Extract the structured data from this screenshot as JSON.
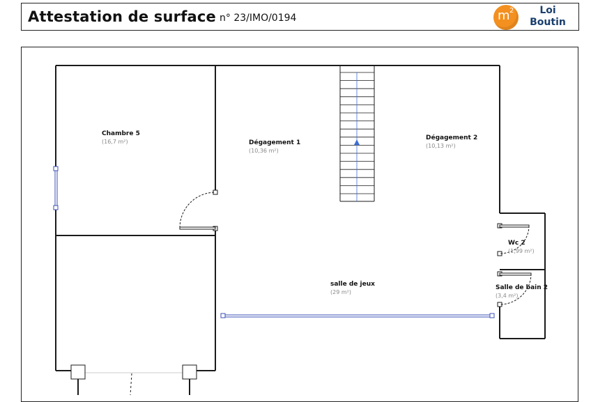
{
  "header": {
    "title": "Attestation de surface",
    "number": "n° 23/IMO/0194",
    "logo": {
      "symbol": "m",
      "superscript": "2",
      "brand_line1": "Loi",
      "brand_line2": "Boutin",
      "circle_color": "#f39020",
      "brand_color": "#1b3f6e"
    }
  },
  "plan": {
    "rooms": [
      {
        "name": "Chambre 5",
        "area": "(16,7 m²)"
      },
      {
        "name": "Dégagement 1",
        "area": "(10,36 m²)"
      },
      {
        "name": "Dégagement 2",
        "area": "(10,13 m²)"
      },
      {
        "name": "Wc 2",
        "area": "(1,99 m²)"
      },
      {
        "name": "salle de jeux",
        "area": "(29 m²)"
      },
      {
        "name": "Salle de bain 2",
        "area": "(3,4 m²)"
      }
    ],
    "wall_color": "#1a1a1a",
    "window_color": "#3a4fb5",
    "stair_arrow_color": "#3d6fd6"
  }
}
